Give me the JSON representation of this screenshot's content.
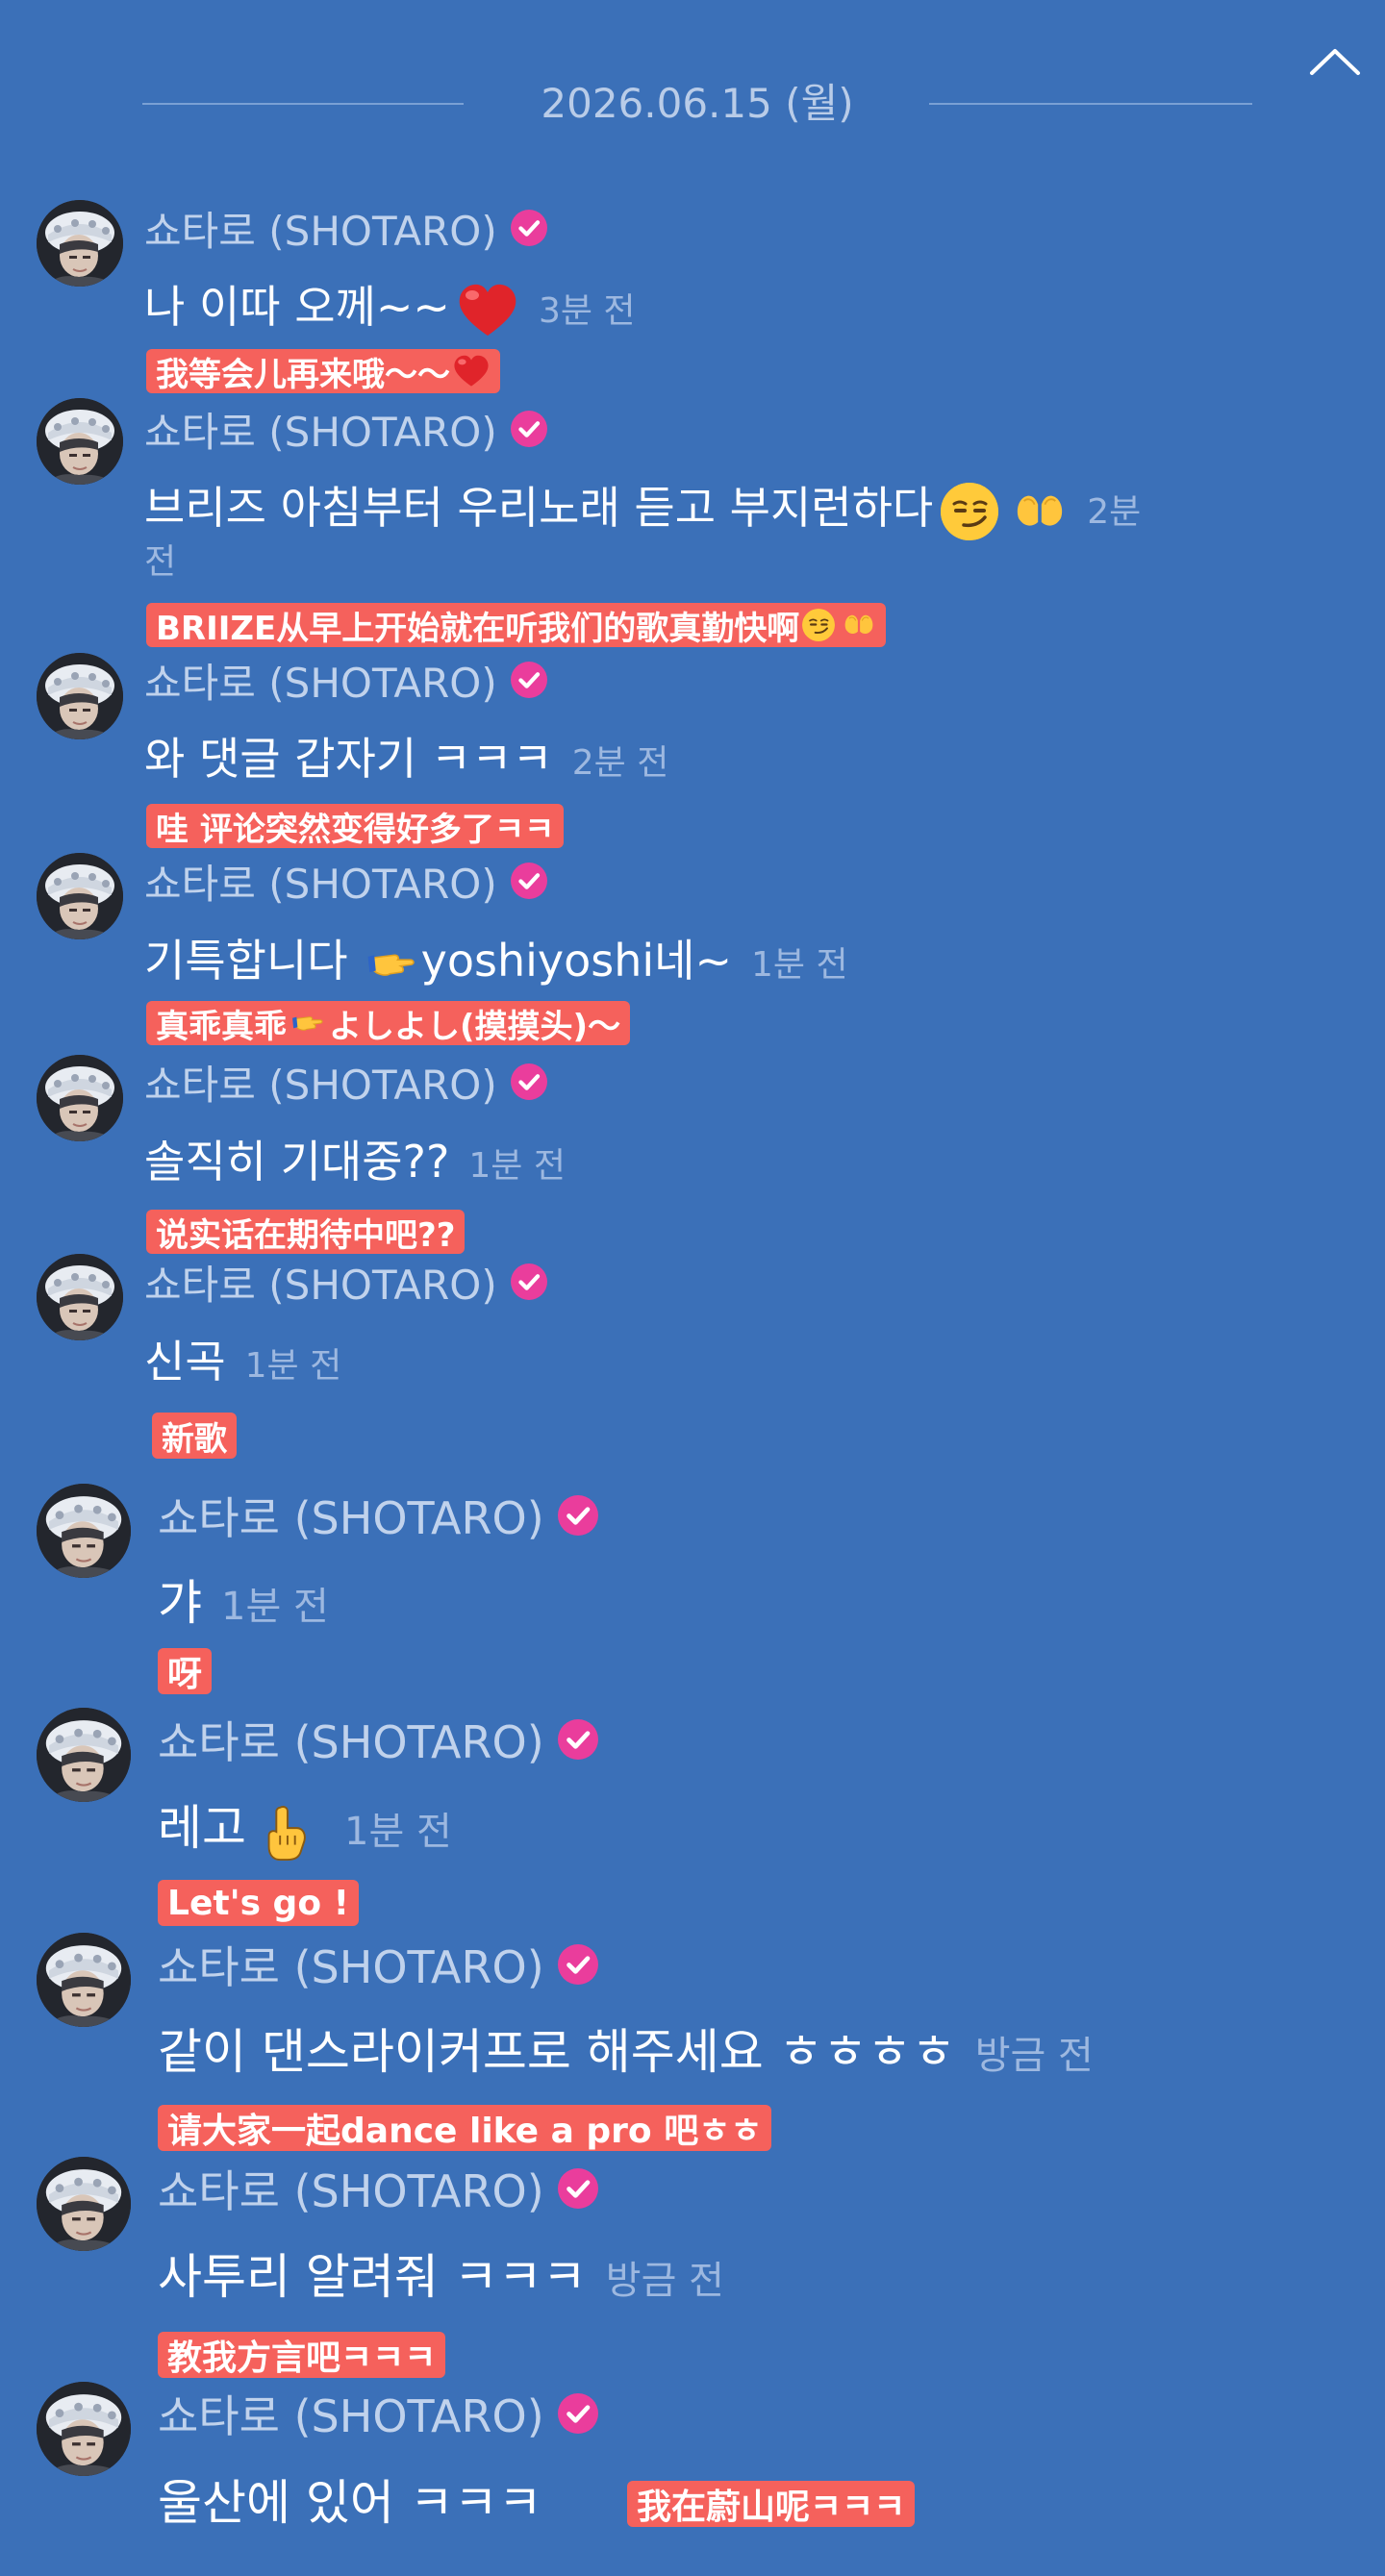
{
  "header": {
    "date": "2026.06.15 (월)",
    "collapse_icon": "chevron-up-icon"
  },
  "colors": {
    "background": "#3b70b8",
    "verified_badge": "#ea3d9c",
    "translation_bg": "#f5615c",
    "name_text": "#c0d2ec",
    "time_text": "#9db8e0"
  },
  "messages": [
    {
      "author": "쇼타로 (SHOTARO)",
      "text": "나 이따 오께~~",
      "time": "3분 전",
      "translation": "我等会儿再来哦～～"
    },
    {
      "author": "쇼타로 (SHOTARO)",
      "text": "브리즈 아침부터 우리노래 듣고 부지런하다",
      "time": "2분",
      "time_cont": "전",
      "translation": "BRIIZE从早上开始就在听我们的歌真勤快啊"
    },
    {
      "author": "쇼타로 (SHOTARO)",
      "text": "와 댓글 갑자기 ㅋㅋㅋ",
      "time": "2분 전",
      "translation": "哇 评论突然变得好多了ㅋㅋ"
    },
    {
      "author": "쇼타로 (SHOTARO)",
      "text": "기특합니다",
      "text2": "yoshiyoshi네~",
      "time": "1분 전",
      "translation": "真乖真乖",
      "translation2": "よしよし(摸摸头)～"
    },
    {
      "author": "쇼타로 (SHOTARO)",
      "text": "솔직히 기대중??",
      "time": "1분 전",
      "translation": "说实话在期待中吧??"
    },
    {
      "author": "쇼타로 (SHOTARO)",
      "text": "신곡",
      "time": "1분 전",
      "translation": "新歌"
    },
    {
      "author": "쇼타로 (SHOTARO)",
      "text": "갸",
      "time": "1분 전",
      "translation": "呀"
    },
    {
      "author": "쇼타로 (SHOTARO)",
      "text": "레고",
      "time": "1분 전",
      "translation": "Let's go !"
    },
    {
      "author": "쇼타로 (SHOTARO)",
      "text": "같이 댄스라이커프로 해주세요 ㅎㅎㅎㅎ",
      "time": "방금 전",
      "translation": "请大家一起dance like a pro 吧ㅎㅎ"
    },
    {
      "author": "쇼타로 (SHOTARO)",
      "text": "사투리 알려줘 ㅋㅋㅋ",
      "time": "방금 전",
      "translation": "教我方言吧ㅋㅋㅋ"
    },
    {
      "author": "쇼타로 (SHOTARO)",
      "text": "울산에 있어 ㅋㅋㅋ",
      "translation": "我在蔚山呢ㅋㅋㅋ"
    }
  ]
}
